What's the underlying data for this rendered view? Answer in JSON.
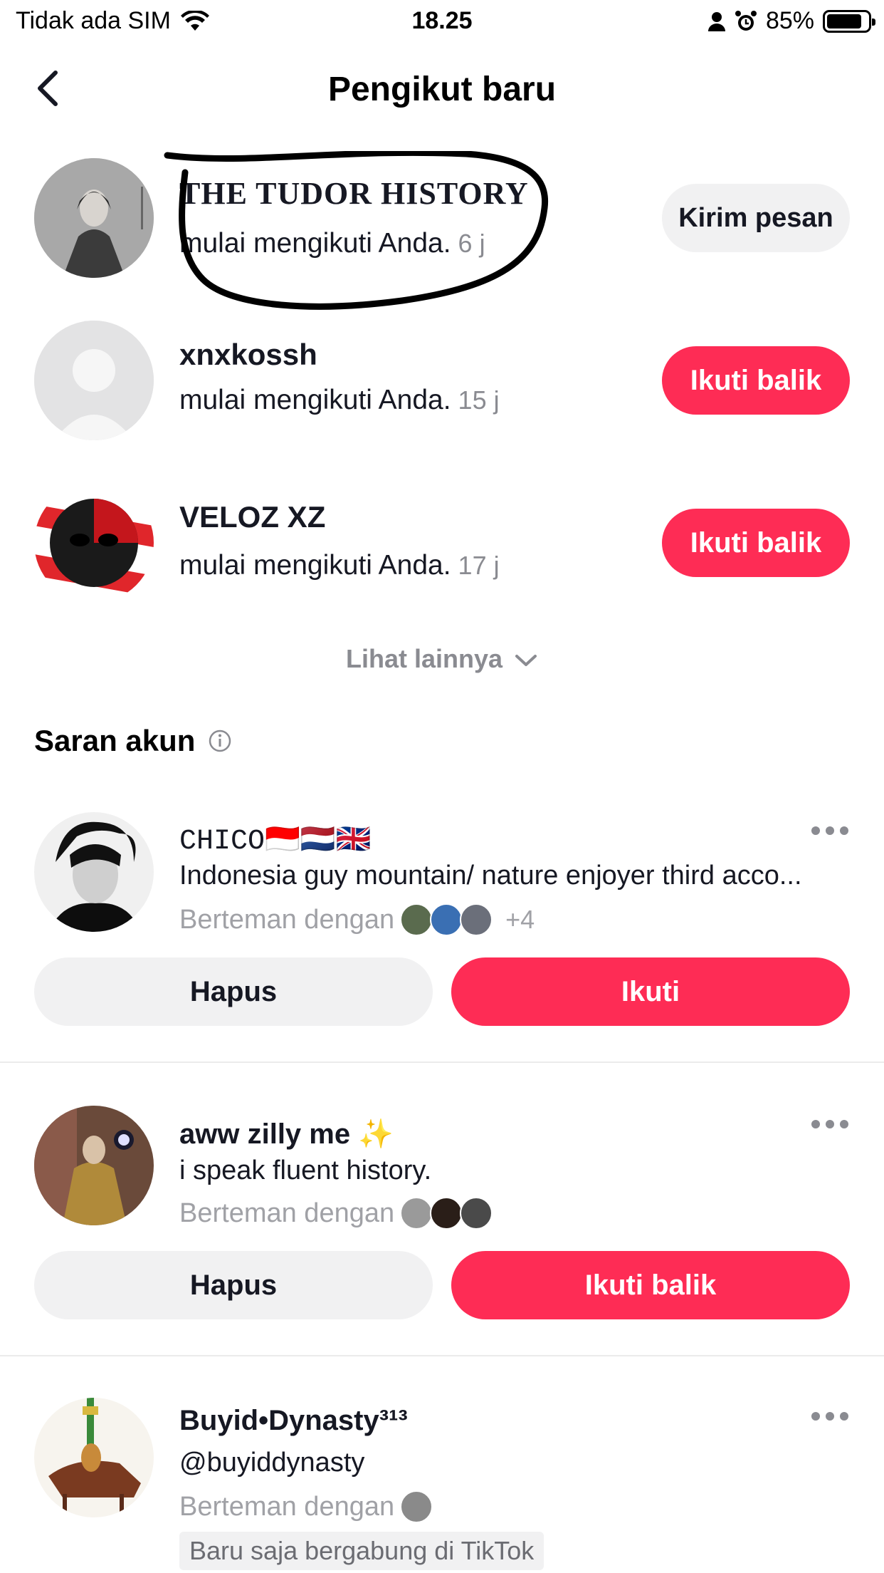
{
  "status_bar": {
    "carrier": "Tidak ada SIM",
    "time": "18.25",
    "battery": "85%",
    "battery_level": 0.85
  },
  "header": {
    "title": "Pengikut baru"
  },
  "followers": [
    {
      "name": "THE TUDOR HISTORY",
      "action": "mulai mengikuti Anda.",
      "time": "6 j",
      "button": "Kirim pesan"
    },
    {
      "name": "xnxkossh",
      "action": "mulai mengikuti Anda.",
      "time": "15 j",
      "button": "Ikuti balik"
    },
    {
      "name": "VELOZ XZ",
      "action": "mulai mengikuti Anda.",
      "time": "17 j",
      "button": "Ikuti balik"
    }
  ],
  "see_more": "Lihat lainnya",
  "suggestions_title": "Saran akun",
  "suggestions": [
    {
      "name": "CHICO🇮🇩🇳🇱🇬🇧",
      "bio": "Indonesia guy mountain/ nature enjoyer third acco...",
      "friends_label": "Berteman dengan",
      "friends_more": "+4",
      "remove": "Hapus",
      "follow": "Ikuti"
    },
    {
      "name": "aww zilly me ✨",
      "bio": "i speak fluent history.",
      "friends_label": "Berteman dengan",
      "remove": "Hapus",
      "follow": "Ikuti balik"
    },
    {
      "name": "Buyid•Dynasty³¹³",
      "bio": "@buyiddynasty",
      "friends_label": "Berteman dengan",
      "tag": "Baru saja bergabung di TikTok"
    }
  ],
  "colors": {
    "accent": "#fe2c55",
    "pill_gray": "#f1f1f2",
    "muted_text": "#8a8b91"
  }
}
